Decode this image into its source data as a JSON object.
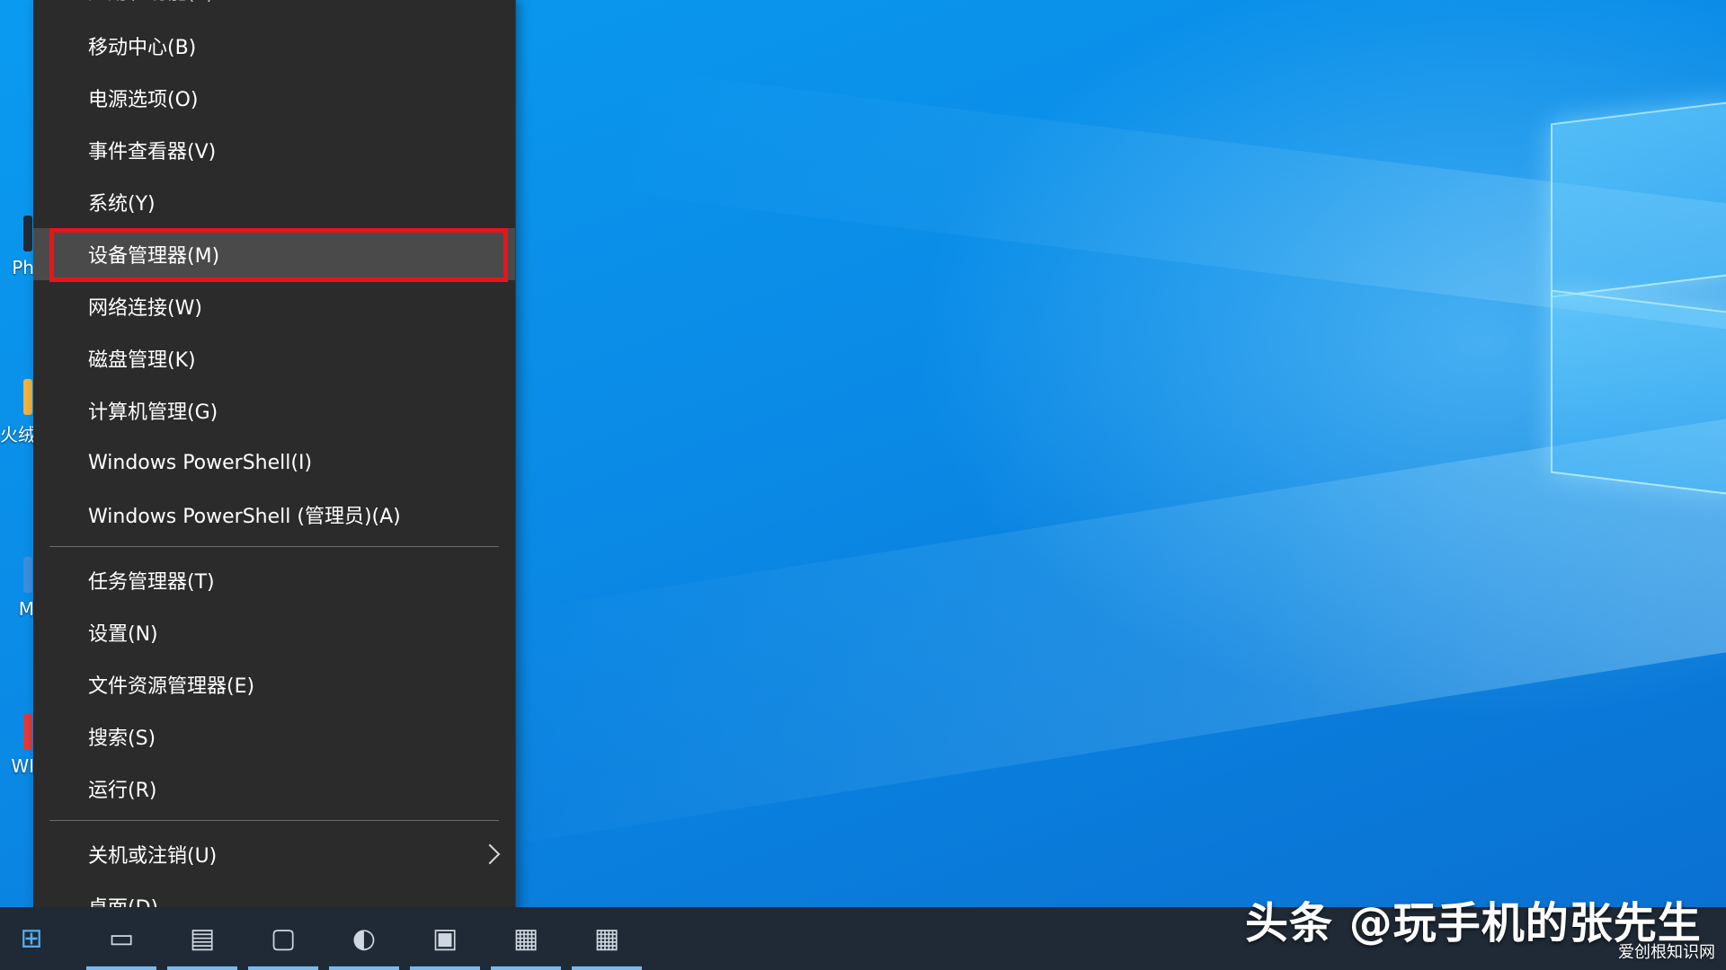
{
  "menu": {
    "top_partial": "应用和功能(F)",
    "items": [
      {
        "label": "移动中心(B)"
      },
      {
        "label": "电源选项(O)"
      },
      {
        "label": "事件查看器(V)"
      },
      {
        "label": "系统(Y)"
      },
      {
        "label": "设备管理器(M)",
        "highlighted": true
      },
      {
        "label": "网络连接(W)"
      },
      {
        "label": "磁盘管理(K)"
      },
      {
        "label": "计算机管理(G)"
      },
      {
        "label": "Windows PowerShell(I)"
      },
      {
        "label": "Windows PowerShell (管理员)(A)"
      }
    ],
    "items2": [
      {
        "label": "任务管理器(T)"
      },
      {
        "label": "设置(N)"
      },
      {
        "label": "文件资源管理器(E)"
      },
      {
        "label": "搜索(S)"
      },
      {
        "label": "运行(R)"
      }
    ],
    "items3": [
      {
        "label": "关机或注销(U)",
        "submenu": true
      },
      {
        "label": "桌面(D)"
      }
    ],
    "highlight_color": "#e8141c"
  },
  "desktop_icons": [
    {
      "label": "Ph"
    },
    {
      "label": "火绒"
    },
    {
      "label": "M"
    },
    {
      "label": "WI"
    }
  ],
  "watermark": {
    "text": "头条 @玩手机的张先生",
    "corner": "爱创根知识网"
  },
  "colors": {
    "menu_bg": "#2b2b2b",
    "active_item_bg": "#4a4a4a",
    "taskbar_bg": "#1f2a36",
    "desktop_blue": "#0a8ae6"
  }
}
